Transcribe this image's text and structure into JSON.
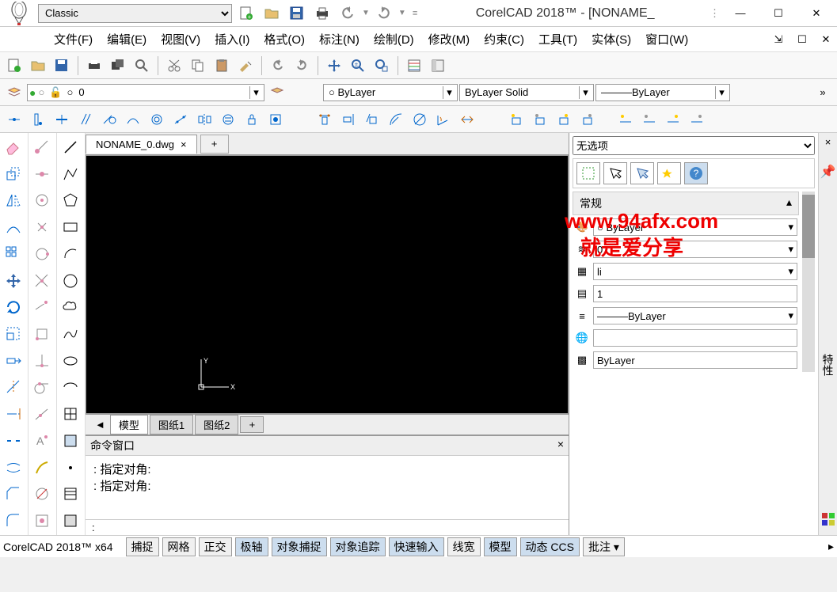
{
  "title": "CorelCAD 2018™ - [NONAME_",
  "workspace": "Classic",
  "menus": [
    "文件(F)",
    "编辑(E)",
    "视图(V)",
    "插入(I)",
    "格式(O)",
    "标注(N)",
    "绘制(D)",
    "修改(M)",
    "约束(C)",
    "工具(T)",
    "实体(S)",
    "窗口(W)"
  ],
  "layer": {
    "name": "0",
    "colorSwatch": "○"
  },
  "bylayerColor": "○ ByLayer",
  "linetype": "ByLayer      Solid",
  "lineweight": "———ByLayer",
  "fileTab": "NONAME_0.dwg",
  "sheets": [
    "模型",
    "图纸1",
    "图纸2"
  ],
  "noSelection": "无选项",
  "propGroup": "常规",
  "props": {
    "color": "○ ByLayer",
    "layer": "0",
    "scale": "1",
    "one": "1",
    "lw": "———ByLayer",
    "blank": "",
    "last": "ByLayer"
  },
  "scaleRow": "li",
  "sideLabel": "特性",
  "cmdTitle": "命令窗口",
  "cmdLines": [
    ": 指定对角:",
    ": 指定对角:"
  ],
  "cmdPrompt": ":",
  "statusLeft": "CorelCAD 2018™ x64",
  "statusButtons": [
    "捕捉",
    "网格",
    "正交",
    "极轴",
    "对象捕捉",
    "对象追踪",
    "快速输入",
    "线宽",
    "模型",
    "动态 CCS",
    "批注 ▾"
  ],
  "watermark1": "www.94afx.com",
  "watermark2": "就是爱分享"
}
